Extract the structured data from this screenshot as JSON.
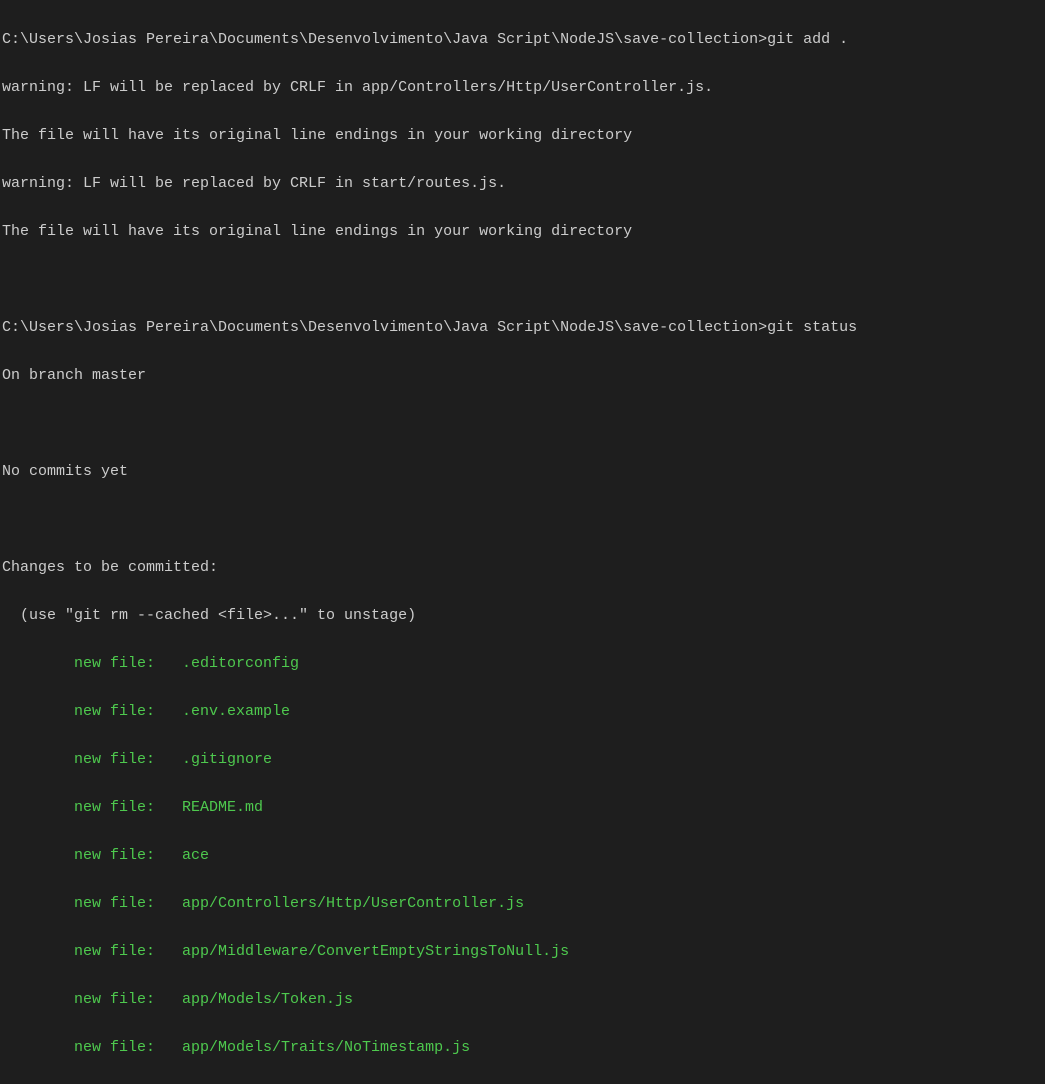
{
  "line1_prompt": "C:\\Users\\Josias Pereira\\Documents\\Desenvolvimento\\Java Script\\NodeJS\\save-collection>",
  "line1_cmd": "git add .",
  "line2": "warning: LF will be replaced by CRLF in app/Controllers/Http/UserController.js.",
  "line3": "The file will have its original line endings in your working directory",
  "line4": "warning: LF will be replaced by CRLF in start/routes.js.",
  "line5": "The file will have its original line endings in your working directory",
  "line7_prompt": "C:\\Users\\Josias Pereira\\Documents\\Desenvolvimento\\Java Script\\NodeJS\\save-collection>",
  "line7_cmd": "git status",
  "line8": "On branch master",
  "line10": "No commits yet",
  "line12": "Changes to be committed:",
  "line13": "  (use \"git rm --cached <file>...\" to unstage)",
  "file1": "        new file:   .editorconfig",
  "file2": "        new file:   .env.example",
  "file3": "        new file:   .gitignore",
  "file4": "        new file:   README.md",
  "file5": "        new file:   ace",
  "file6": "        new file:   app/Controllers/Http/UserController.js",
  "file7": "        new file:   app/Middleware/ConvertEmptyStringsToNull.js",
  "file8": "        new file:   app/Models/Token.js",
  "file9": "        new file:   app/Models/Traits/NoTimestamp.js"
}
